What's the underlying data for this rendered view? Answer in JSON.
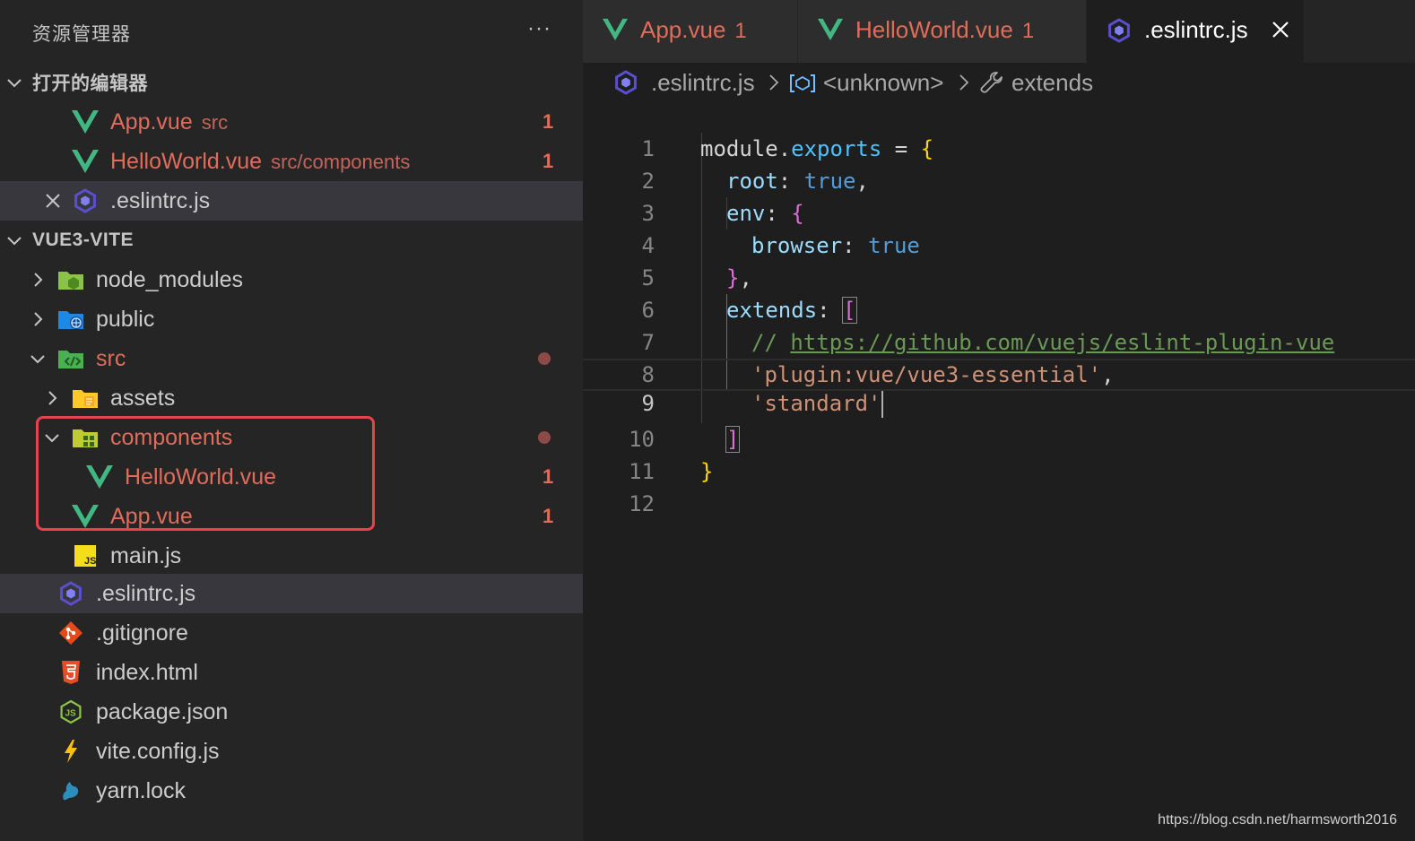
{
  "sidebar": {
    "title": "资源管理器",
    "more": "···",
    "open_editors": {
      "title": "打开的编辑器",
      "items": [
        {
          "name": "App.vue",
          "path": "src",
          "badge": "1"
        },
        {
          "name": "HelloWorld.vue",
          "path": "src/components",
          "badge": "1"
        },
        {
          "name": ".eslintrc.js",
          "path": ""
        }
      ]
    },
    "project": {
      "title": "VUE3-VITE",
      "items": [
        {
          "name": "node_modules",
          "icon": "node-modules-folder-icon"
        },
        {
          "name": "public",
          "icon": "public-folder-icon"
        },
        {
          "name": "src",
          "icon": "src-folder-icon"
        },
        {
          "name": "assets",
          "icon": "assets-folder-icon"
        },
        {
          "name": "components",
          "icon": "components-folder-icon"
        },
        {
          "name": "HelloWorld.vue",
          "icon": "vue-icon",
          "badge": "1"
        },
        {
          "name": "App.vue",
          "icon": "vue-icon",
          "badge": "1"
        },
        {
          "name": "main.js",
          "icon": "js-icon"
        },
        {
          "name": ".eslintrc.js",
          "icon": "eslint-icon"
        },
        {
          "name": ".gitignore",
          "icon": "git-icon"
        },
        {
          "name": "index.html",
          "icon": "html-icon"
        },
        {
          "name": "package.json",
          "icon": "nodejs-icon"
        },
        {
          "name": "vite.config.js",
          "icon": "vite-icon"
        },
        {
          "name": "yarn.lock",
          "icon": "yarn-icon"
        }
      ]
    }
  },
  "tabs": [
    {
      "label": "App.vue",
      "badge": "1"
    },
    {
      "label": "HelloWorld.vue",
      "badge": "1"
    },
    {
      "label": ".eslintrc.js",
      "badge": ""
    }
  ],
  "breadcrumb": {
    "file": ".eslintrc.js",
    "symbol": "<unknown>",
    "prop": "extends"
  },
  "code": {
    "line_numbers": [
      "1",
      "2",
      "3",
      "4",
      "5",
      "6",
      "7",
      "8",
      "9",
      "10",
      "11",
      "12"
    ],
    "tokens": {
      "l1_module": "module",
      "l1_dot": ".",
      "l1_exports": "exports",
      "l1_eq": " = ",
      "l1_brace": "{",
      "l2_root": "root",
      "l2_colon": ": ",
      "l2_true": "true",
      "l2_comma": ",",
      "l3_env": "env",
      "l3_colon": ": ",
      "l3_brace": "{",
      "l4_browser": "browser",
      "l4_colon": ": ",
      "l4_true": "true",
      "l5_brace": "}",
      "l5_comma": ",",
      "l6_extends": "extends",
      "l6_colon": ": ",
      "l6_bracket": "[",
      "l7_comment": "// ",
      "l7_url": "https://github.com/vuejs/eslint-plugin-vue",
      "l8_str": "'plugin:vue/vue3-essential'",
      "l8_comma": ",",
      "l9_str": "'standard'",
      "l10_bracket": "]",
      "l11_brace": "}"
    }
  },
  "watermark": "https://blog.csdn.net/harmsworth2016",
  "colors": {
    "modified": "#e06c5a",
    "vue": "#41b883",
    "eslint": "#4b32c3",
    "highlight_box": "#e8434b"
  }
}
